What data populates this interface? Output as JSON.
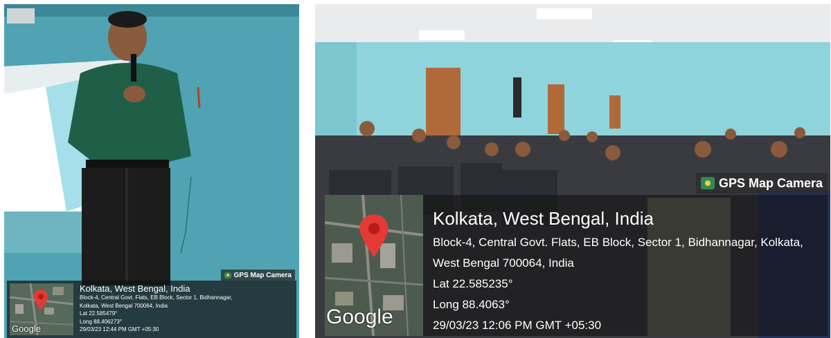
{
  "left_photo": {
    "badge": {
      "text": "GPS Map Camera",
      "icon": "camera-icon"
    },
    "location": {
      "city": "Kolkata, West Bengal, India",
      "address_line1": "Block-4, Central Govt. Flats, EB Block, Sector 1, Bidhannagar,",
      "address_line2": "Kolkata, West Bengal 700064, India",
      "lat": "Lat 22.585479°",
      "long": "Long 88.406273°",
      "datetime": "29/03/23 12:44 PM GMT +05:30"
    },
    "map": {
      "brand": "Google",
      "pin_icon": "map-pin-icon"
    }
  },
  "right_photo": {
    "badge": {
      "text": "GPS Map Camera",
      "icon": "camera-icon"
    },
    "location": {
      "city": "Kolkata, West Bengal, India",
      "address_line1": "Block-4, Central Govt. Flats, EB Block, Sector 1, Bidhannagar, Kolkata,",
      "address_line2": "West Bengal 700064, India",
      "lat": "Lat 22.585235°",
      "long": "Long 88.4063°",
      "datetime": "29/03/23 12:06 PM GMT +05:30"
    },
    "map": {
      "brand": "Google",
      "pin_icon": "map-pin-icon"
    }
  },
  "colors": {
    "wall_left": "#4fa3b2",
    "wall_right": "#8fd4dc",
    "pin": "#e53935",
    "overlay": "#141414"
  }
}
